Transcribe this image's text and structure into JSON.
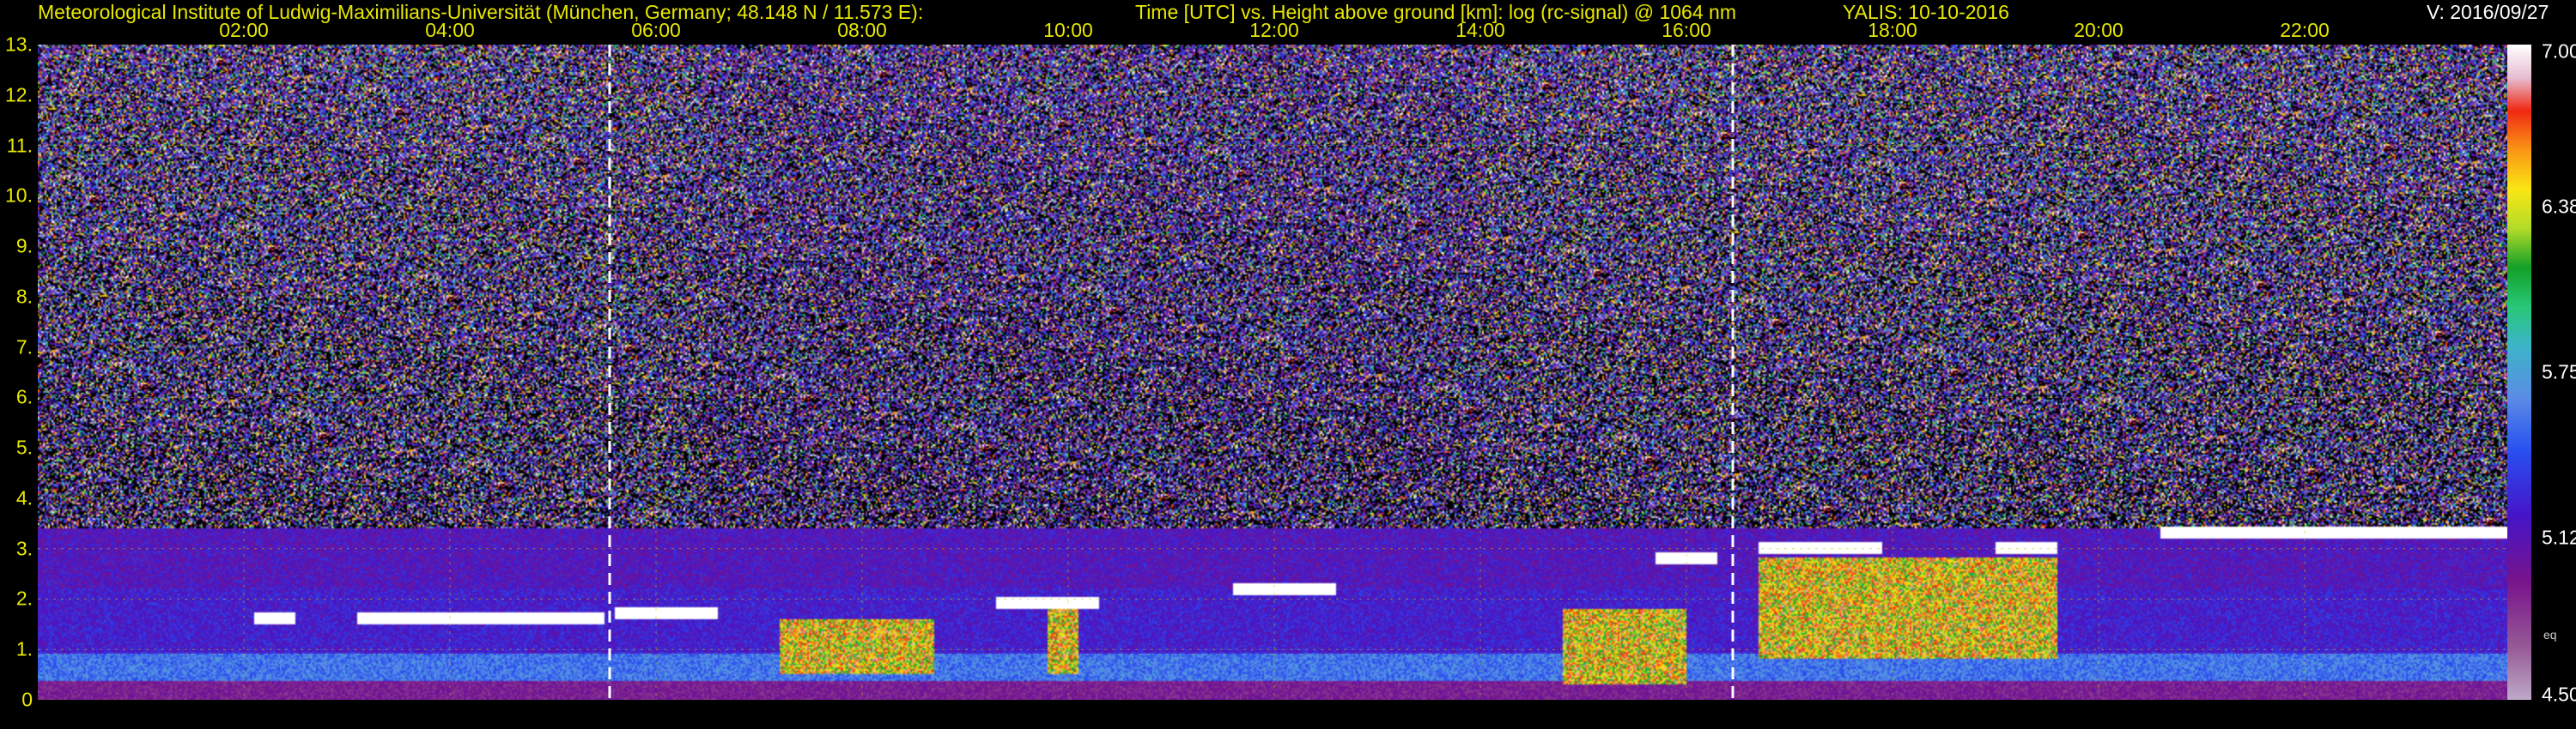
{
  "header": {
    "institute": "Meteorological Institute of Ludwig-Maximilians-Universität (München, Germany; 48.148 N / 11.573 E):",
    "plot_title": "Time [UTC] vs. Height above ground [km]: log (rc-signal) @ 1064 nm",
    "instrument_date": "YALIS: 10-10-2016",
    "version": "V: 2016/09/27"
  },
  "chart_data": {
    "type": "heatmap",
    "title": "Time [UTC] vs. Height above ground [km]: log (rc-signal) @ 1064 nm",
    "xlabel": "Time [UTC]",
    "ylabel": "Height above ground [km]",
    "x_ticks": [
      "02:00",
      "04:00",
      "06:00",
      "08:00",
      "10:00",
      "12:00",
      "14:00",
      "16:00",
      "18:00",
      "20:00",
      "22:00"
    ],
    "x_tick_hours": [
      2,
      4,
      6,
      8,
      10,
      12,
      14,
      16,
      18,
      20,
      22
    ],
    "xlim_hours": [
      0,
      24
    ],
    "y_ticks": [
      "0",
      "1.",
      "2.",
      "3.",
      "4.",
      "5.",
      "6.",
      "7.",
      "8.",
      "9.",
      "10.",
      "11.",
      "12.",
      "13."
    ],
    "ylim": [
      0,
      13
    ],
    "grid": true,
    "colorbar": {
      "ticks": [
        "7.00",
        "6.38",
        "5.75",
        "5.12",
        "4.50"
      ],
      "tick_values": [
        7.0,
        6.38,
        5.75,
        5.12,
        4.5
      ],
      "range": [
        4.5,
        7.0
      ],
      "unit": "eq"
    },
    "dashed_time_markers_hours": [
      5.55,
      16.45
    ],
    "cloud_layers": [
      {
        "start_h": 2.1,
        "end_h": 2.5,
        "height_km": 1.6
      },
      {
        "start_h": 3.1,
        "end_h": 5.5,
        "height_km": 1.6
      },
      {
        "start_h": 5.6,
        "end_h": 6.6,
        "height_km": 1.7
      },
      {
        "start_h": 9.3,
        "end_h": 10.3,
        "height_km": 1.9
      },
      {
        "start_h": 11.6,
        "end_h": 12.6,
        "height_km": 2.2
      },
      {
        "start_h": 15.7,
        "end_h": 16.3,
        "height_km": 2.8
      },
      {
        "start_h": 16.7,
        "end_h": 17.9,
        "height_km": 3.0
      },
      {
        "start_h": 19.0,
        "end_h": 19.6,
        "height_km": 3.0
      },
      {
        "start_h": 20.6,
        "end_h": 24.0,
        "height_km": 3.3
      }
    ],
    "aerosol_layers": [
      {
        "start_h": 7.2,
        "end_h": 8.7,
        "bottom_km": 0.5,
        "top_km": 1.6
      },
      {
        "start_h": 9.8,
        "end_h": 10.1,
        "bottom_km": 0.5,
        "top_km": 1.8
      },
      {
        "start_h": 14.8,
        "end_h": 16.0,
        "bottom_km": 0.3,
        "top_km": 1.8
      },
      {
        "start_h": 16.7,
        "end_h": 19.6,
        "bottom_km": 0.8,
        "top_km": 2.8
      }
    ]
  },
  "colors": {
    "tick_text": "#e8e800",
    "background": "#000000",
    "grid": "#c8c800"
  }
}
